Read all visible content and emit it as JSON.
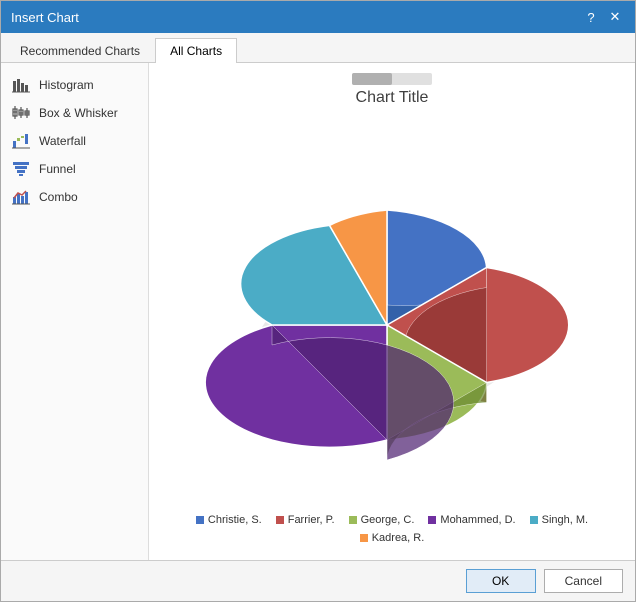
{
  "dialog": {
    "title": "Insert Chart",
    "help_btn": "?",
    "close_btn": "✕"
  },
  "tabs": [
    {
      "label": "Recommended Charts",
      "active": false
    },
    {
      "label": "All Charts",
      "active": true
    }
  ],
  "chart_types": [
    {
      "name": "Histogram",
      "icon": "histogram"
    },
    {
      "name": "Box & Whisker",
      "icon": "box-whisker"
    },
    {
      "name": "Waterfall",
      "icon": "waterfall"
    },
    {
      "name": "Funnel",
      "icon": "funnel"
    },
    {
      "name": "Combo",
      "icon": "combo"
    }
  ],
  "chart": {
    "title": "Chart Title",
    "segments": [
      {
        "name": "Christie, S.",
        "color": "#4472c4",
        "startAngle": -90,
        "endAngle": -30
      },
      {
        "name": "Farrier, P.",
        "color": "#c0504d",
        "startAngle": -30,
        "endAngle": 30
      },
      {
        "name": "George, C.",
        "color": "#9bbb59",
        "startAngle": 30,
        "endAngle": 90
      },
      {
        "name": "Mohammed, D.",
        "color": "#7030a0",
        "startAngle": 90,
        "endAngle": 195
      },
      {
        "name": "Singh, M.",
        "color": "#4bacc6",
        "startAngle": 195,
        "endAngle": 270
      },
      {
        "name": "Kadrea, R.",
        "color": "#f79646",
        "startAngle": 270,
        "endAngle": 330
      }
    ]
  },
  "legend": [
    {
      "label": "Christie, S.",
      "color": "#4472c4"
    },
    {
      "label": "Farrier, P.",
      "color": "#c0504d"
    },
    {
      "label": "George, C.",
      "color": "#9bbb59"
    },
    {
      "label": "Mohammed, D.",
      "color": "#7030a0"
    },
    {
      "label": "Singh, M.",
      "color": "#4bacc6"
    },
    {
      "label": "Kadrea, R.",
      "color": "#f79646"
    }
  ],
  "footer": {
    "ok_label": "OK",
    "cancel_label": "Cancel"
  }
}
